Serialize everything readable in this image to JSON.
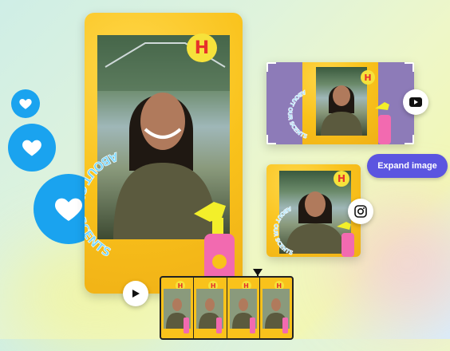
{
  "story_card": {
    "badge_letter": "H",
    "curved_text": "ABOUT OUR SCENTS"
  },
  "youtube_card": {
    "badge_letter": "H",
    "curved_text": "ABOUT OUR SCENTS",
    "platform_icon": "youtube-icon"
  },
  "instagram_card": {
    "badge_letter": "H",
    "curved_text": "ABOUT OUR SCENTS",
    "platform_icon": "instagram-icon"
  },
  "expand_button": {
    "label": "Expand image"
  },
  "timeline": {
    "frames": [
      {
        "badge_letter": "H"
      },
      {
        "badge_letter": "H"
      },
      {
        "badge_letter": "H"
      },
      {
        "badge_letter": "H"
      }
    ]
  },
  "colors": {
    "accent": "#5b55e0",
    "heart_blue": "#1aa3ef",
    "yellow": "#f9c21b",
    "purple": "#8d7bb8"
  }
}
